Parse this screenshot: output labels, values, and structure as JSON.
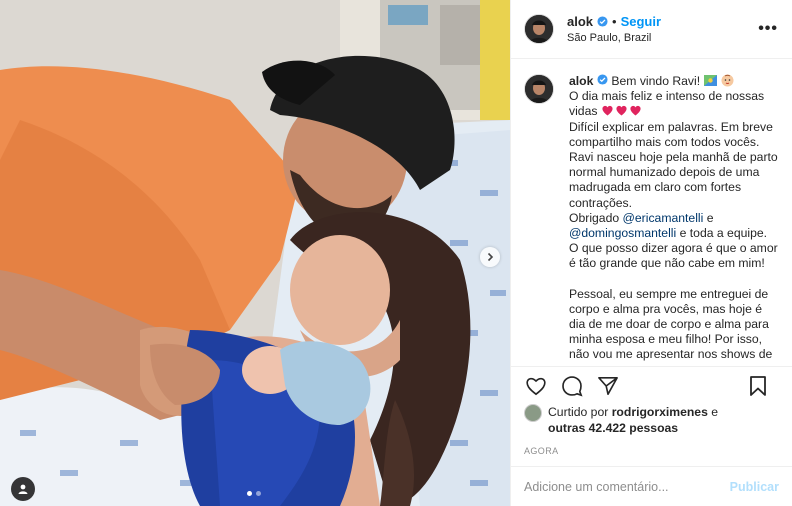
{
  "post": {
    "username": "alok",
    "follow_label": "Seguir",
    "separator": "•",
    "location": "São Paulo, Brazil",
    "more_label": "•••"
  },
  "caption": {
    "username": "alok",
    "intro": "Bem vindo Ravi!",
    "line1": "O dia mais feliz e intenso de nossas vidas",
    "para1": "Difícil explicar em palavras. Em breve compartilho mais com todos vocês. Ravi nasceu hoje pela manhã de parto normal humanizado depois de uma madrugada em claro com fortes contrações.",
    "thanks_prefix": "Obrigado",
    "mention1": "@ericamantelli",
    "and": "e",
    "mention2": "@domingosmantelli",
    "thanks_suffix": "e toda a equipe.",
    "para2": "O que posso dizer agora é que o amor é tão grande que não cabe em mim!",
    "para3": "Pessoal, eu sempre me entreguei de corpo e alma pra vocês, mas hoje é dia de me doar de corpo e alma para minha esposa e meu filho! Por isso, não vou me apresentar nos shows de"
  },
  "likes": {
    "prefix": "Curtido por",
    "user": "rodrigorximenes",
    "connector": "e",
    "others": "outras 42.422 pessoas"
  },
  "timestamp": "AGORA",
  "comment": {
    "placeholder": "Adicione um comentário...",
    "publish_label": "Publicar"
  },
  "colors": {
    "accent": "#0095f6",
    "mention": "#00376b",
    "publish_disabled": "#b2dffc",
    "verified": "#3897f0"
  },
  "carousel": {
    "current": 1,
    "total": 2
  }
}
